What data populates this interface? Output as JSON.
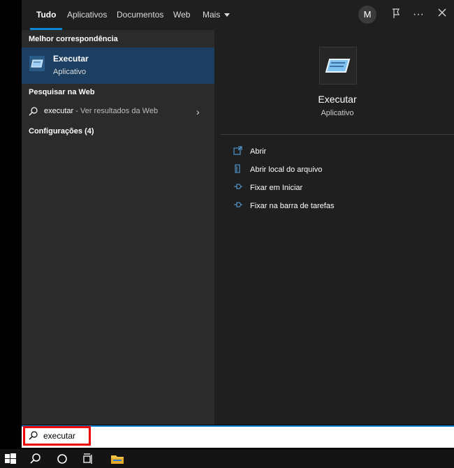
{
  "tabs": [
    {
      "label": "Tudo",
      "active": true
    },
    {
      "label": "Aplicativos"
    },
    {
      "label": "Documentos"
    },
    {
      "label": "Web"
    },
    {
      "label": "Mais"
    }
  ],
  "user": {
    "initial": "M"
  },
  "icons": {
    "feedback": "feedback-icon",
    "more": "ellipsis-icon",
    "close": "close-icon"
  },
  "left": {
    "best_match_title": "Melhor correspondência",
    "best_match": {
      "name": "Executar",
      "type": "Aplicativo"
    },
    "web_title": "Pesquisar na Web",
    "web_row": {
      "query": "executar",
      "suffix": " - Ver resultados da Web"
    },
    "settings_title": "Configurações (4)"
  },
  "right": {
    "title": "Executar",
    "subtitle": "Aplicativo",
    "actions": [
      {
        "label": "Abrir",
        "icon": "open-icon"
      },
      {
        "label": "Abrir local do arquivo",
        "icon": "file-location-icon"
      },
      {
        "label": "Fixar em Iniciar",
        "icon": "pin-icon"
      },
      {
        "label": "Fixar na barra de tarefas",
        "icon": "pin-icon"
      }
    ]
  },
  "search": {
    "value": "executar"
  },
  "colors": {
    "accent": "#0e86d6",
    "selection": "#1b3e61",
    "highlight": "#e00000"
  }
}
